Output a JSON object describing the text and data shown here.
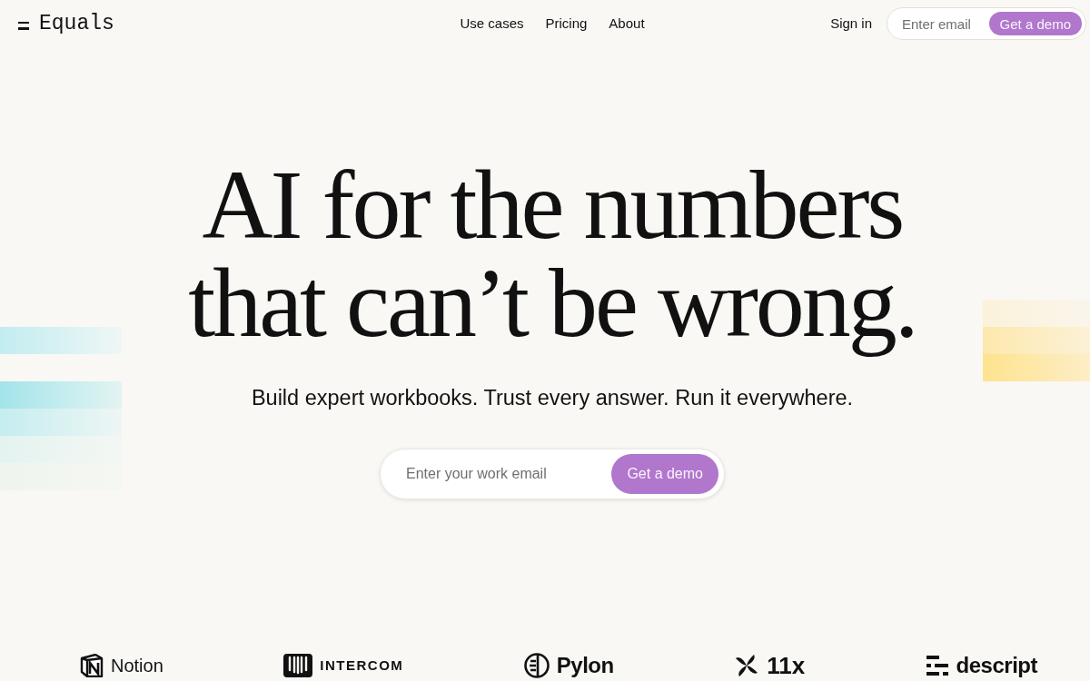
{
  "header": {
    "logo": "Equals",
    "nav": [
      "Use cases",
      "Pricing",
      "About"
    ],
    "sign_in": "Sign in",
    "email_field": {
      "placeholder": "Enter email"
    },
    "demo_button": "Get a demo"
  },
  "hero": {
    "title": "AI for the numbers that can’t be wrong.",
    "subtitle": "Build expert workbooks. Trust every answer. Run it everywhere.",
    "email_field": {
      "placeholder": "Enter your work email"
    },
    "demo_button": "Get a demo"
  },
  "customer_logos": [
    {
      "name": "Notion",
      "kind": "cube"
    },
    {
      "name": "INTERCOM",
      "kind": "grille"
    },
    {
      "name": "Pylon",
      "kind": "disc"
    },
    {
      "name": "11x",
      "kind": "pinwheel"
    },
    {
      "name": "descript",
      "kind": "dashes"
    }
  ]
}
